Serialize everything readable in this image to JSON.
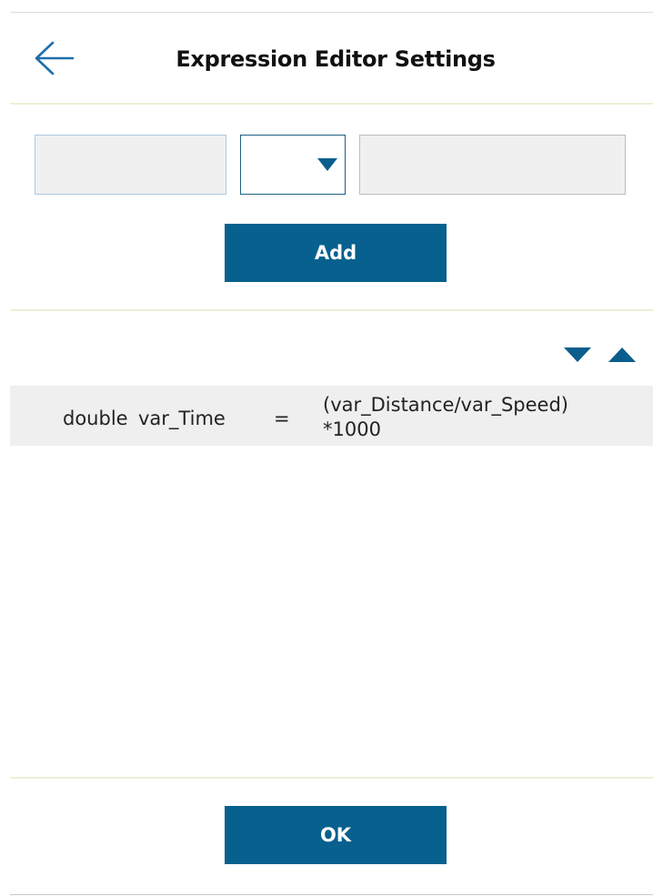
{
  "header": {
    "title": "Expression Editor Settings",
    "back_icon": "arrow-left-icon"
  },
  "form": {
    "left_operand": {
      "value": "",
      "placeholder": ""
    },
    "operator": {
      "selected": ""
    },
    "right_operand": {
      "value": "",
      "placeholder": ""
    },
    "add_label": "Add"
  },
  "list_controls": {
    "move_down_icon": "triangle-down-icon",
    "move_up_icon": "triangle-up-icon"
  },
  "expressions": [
    {
      "type": "double",
      "variable": "var_Time",
      "operator": "=",
      "expression_line1": "(var_Distance/var_Speed)",
      "expression_line2": "*1000"
    }
  ],
  "footer": {
    "ok_label": "OK"
  },
  "colors": {
    "accent": "#07608e",
    "back_arrow": "#1f6fa8",
    "divider": "#eef0d8",
    "row_background": "#efefef"
  }
}
